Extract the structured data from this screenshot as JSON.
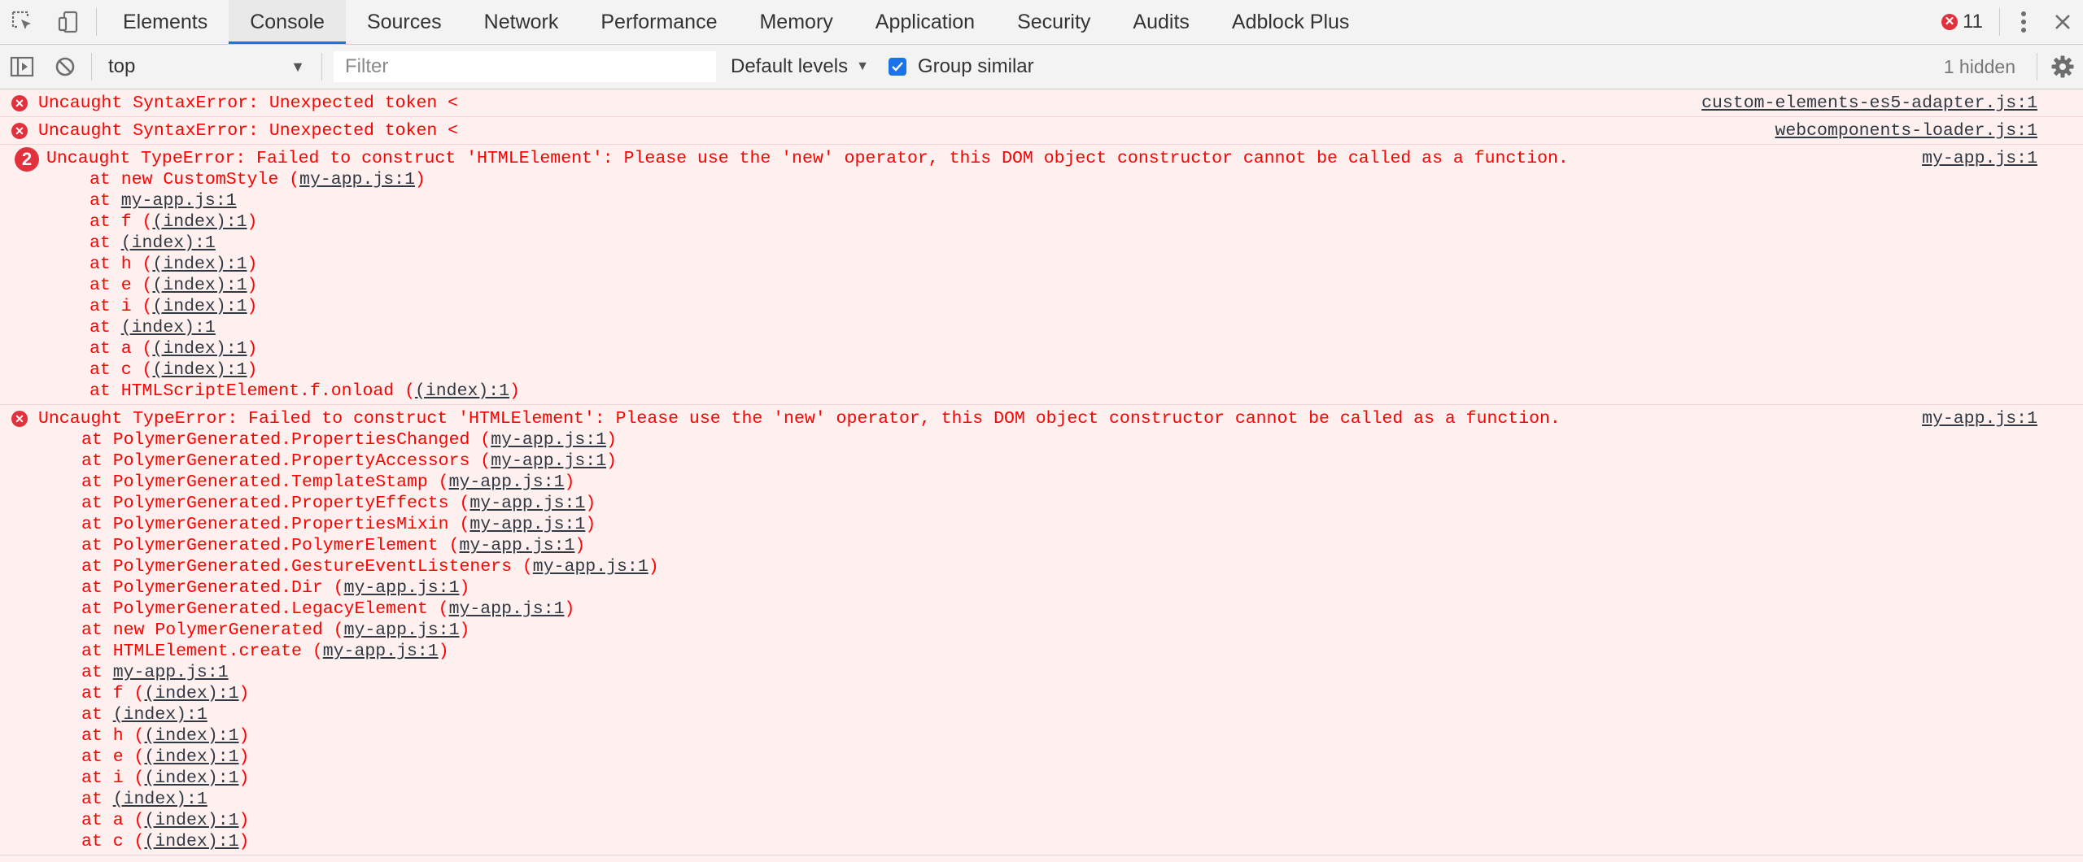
{
  "tabs": [
    {
      "label": "Elements"
    },
    {
      "label": "Console",
      "active": true
    },
    {
      "label": "Sources"
    },
    {
      "label": "Network"
    },
    {
      "label": "Performance"
    },
    {
      "label": "Memory"
    },
    {
      "label": "Application"
    },
    {
      "label": "Security"
    },
    {
      "label": "Audits"
    },
    {
      "label": "Adblock Plus"
    }
  ],
  "error_count": "11",
  "toolbar": {
    "context": "top",
    "filter_placeholder": "Filter",
    "levels": "Default levels",
    "group_similar": "Group similar",
    "hidden": "1 hidden"
  },
  "colors": {
    "error_text": "#ff0000",
    "error_bg": "#fff0f0",
    "accent": "#1a73e8"
  },
  "messages": [
    {
      "text": "Uncaught SyntaxError: Unexpected token <",
      "source": "custom-elements-es5-adapter.js:1",
      "frames": []
    },
    {
      "text": "Uncaught SyntaxError: Unexpected token <",
      "source": "webcomponents-loader.js:1",
      "frames": []
    },
    {
      "count": "2",
      "text": "Uncaught TypeError: Failed to construct 'HTMLElement': Please use the 'new' operator, this DOM object constructor cannot be called as a function.",
      "source": "my-app.js:1",
      "frames": [
        {
          "pre": "at new CustomStyle (",
          "link": "my-app.js:1",
          "post": ")"
        },
        {
          "pre": "at ",
          "link": "my-app.js:1",
          "post": ""
        },
        {
          "pre": "at f (",
          "link": "(index):1",
          "post": ")"
        },
        {
          "pre": "at ",
          "link": "(index):1",
          "post": ""
        },
        {
          "pre": "at h (",
          "link": "(index):1",
          "post": ")"
        },
        {
          "pre": "at e (",
          "link": "(index):1",
          "post": ")"
        },
        {
          "pre": "at i (",
          "link": "(index):1",
          "post": ")"
        },
        {
          "pre": "at ",
          "link": "(index):1",
          "post": ""
        },
        {
          "pre": "at a (",
          "link": "(index):1",
          "post": ")"
        },
        {
          "pre": "at c (",
          "link": "(index):1",
          "post": ")"
        },
        {
          "pre": "at HTMLScriptElement.f.onload (",
          "link": "(index):1",
          "post": ")"
        }
      ]
    },
    {
      "text": "Uncaught TypeError: Failed to construct 'HTMLElement': Please use the 'new' operator, this DOM object constructor cannot be called as a function.",
      "source": "my-app.js:1",
      "frames": [
        {
          "pre": "at PolymerGenerated.PropertiesChanged (",
          "link": "my-app.js:1",
          "post": ")"
        },
        {
          "pre": "at PolymerGenerated.PropertyAccessors (",
          "link": "my-app.js:1",
          "post": ")"
        },
        {
          "pre": "at PolymerGenerated.TemplateStamp (",
          "link": "my-app.js:1",
          "post": ")"
        },
        {
          "pre": "at PolymerGenerated.PropertyEffects (",
          "link": "my-app.js:1",
          "post": ")"
        },
        {
          "pre": "at PolymerGenerated.PropertiesMixin (",
          "link": "my-app.js:1",
          "post": ")"
        },
        {
          "pre": "at PolymerGenerated.PolymerElement (",
          "link": "my-app.js:1",
          "post": ")"
        },
        {
          "pre": "at PolymerGenerated.GestureEventListeners (",
          "link": "my-app.js:1",
          "post": ")"
        },
        {
          "pre": "at PolymerGenerated.Dir (",
          "link": "my-app.js:1",
          "post": ")"
        },
        {
          "pre": "at PolymerGenerated.LegacyElement (",
          "link": "my-app.js:1",
          "post": ")"
        },
        {
          "pre": "at new PolymerGenerated (",
          "link": "my-app.js:1",
          "post": ")"
        },
        {
          "pre": "at HTMLElement.create (",
          "link": "my-app.js:1",
          "post": ")"
        },
        {
          "pre": "at ",
          "link": "my-app.js:1",
          "post": ""
        },
        {
          "pre": "at f (",
          "link": "(index):1",
          "post": ")"
        },
        {
          "pre": "at ",
          "link": "(index):1",
          "post": ""
        },
        {
          "pre": "at h (",
          "link": "(index):1",
          "post": ")"
        },
        {
          "pre": "at e (",
          "link": "(index):1",
          "post": ")"
        },
        {
          "pre": "at i (",
          "link": "(index):1",
          "post": ")"
        },
        {
          "pre": "at ",
          "link": "(index):1",
          "post": ""
        },
        {
          "pre": "at a (",
          "link": "(index):1",
          "post": ")"
        },
        {
          "pre": "at c (",
          "link": "(index):1",
          "post": ")"
        }
      ]
    }
  ]
}
